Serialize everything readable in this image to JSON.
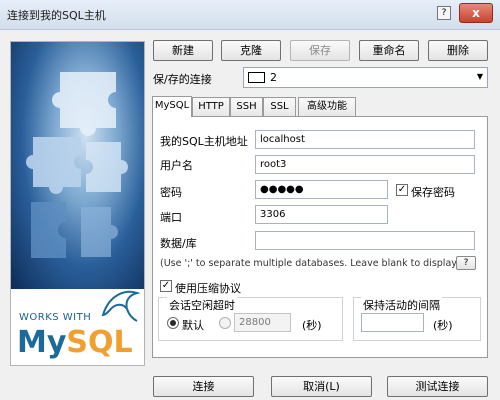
{
  "window": {
    "title": "连接到我的SQL主机",
    "help": "?",
    "close": "x"
  },
  "banner": {
    "works_with": "WORKS WITH",
    "logo_my": "My",
    "logo_sql": "SQL"
  },
  "toolbar": {
    "new": "新建",
    "clone": "克隆",
    "save": "保存",
    "rename": "重命名",
    "delete": "删除"
  },
  "saved_connections": {
    "label": "保/存的连接",
    "selected": "2"
  },
  "tabs": [
    "MySQL",
    "HTTP",
    "SSH",
    "SSL",
    "高级功能"
  ],
  "form": {
    "host_label": "我的SQL主机地址",
    "host_value": "localhost",
    "user_label": "用户名",
    "user_value": "root3",
    "password_label": "密码",
    "password_value": "●●●●●",
    "save_password_label": "保存密码",
    "port_label": "端口",
    "port_value": "3306",
    "database_label": "数据/库",
    "database_value": "",
    "database_hint": "(Use ';' to separate multiple databases. Leave blank to display all)",
    "hint_button": "?",
    "compression_label": "使用压缩协议",
    "session_timeout_label": "会话空闲超时",
    "default_label": "默认",
    "timeout_value": "28800",
    "seconds_label": "(秒)",
    "keepalive_label": "保持活动的间隔",
    "keepalive_value": "",
    "keepalive_seconds_label": "(秒)"
  },
  "footer": {
    "connect": "连接",
    "cancel": "取消(L)",
    "test": "测试连接"
  }
}
